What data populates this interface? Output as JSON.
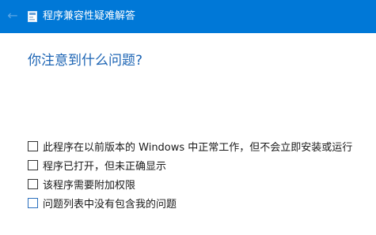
{
  "window": {
    "title": "程序兼容性疑难解答",
    "back_icon": "back-arrow-icon",
    "app_icon": "troubleshooter-icon",
    "titlebar_color": "#0078d7"
  },
  "main": {
    "question": "你注意到什么问题?",
    "question_color": "#1c64b4",
    "options": [
      {
        "label": "此程序在以前版本的 Windows 中正常工作，但不会立即安装或运行",
        "checked": false
      },
      {
        "label": "程序已打开，但未正确显示",
        "checked": false
      },
      {
        "label": "该程序需要附加权限",
        "checked": false
      },
      {
        "label": "问题列表中没有包含我的问题",
        "checked": false
      }
    ]
  }
}
